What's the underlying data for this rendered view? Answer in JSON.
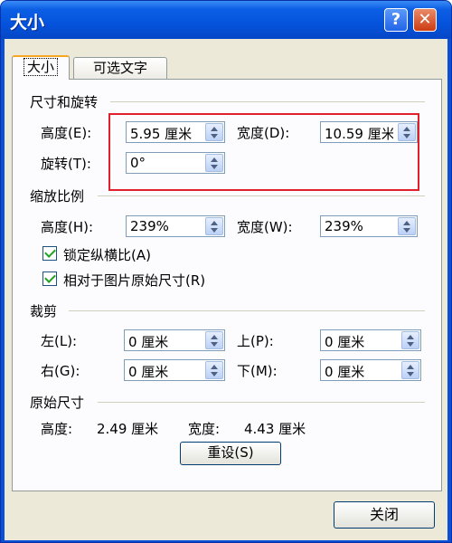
{
  "window": {
    "title": "大小",
    "help_glyph": "?",
    "close_glyph": "✕"
  },
  "tabs": [
    {
      "label": "大小",
      "active": true
    },
    {
      "label": "可选文字",
      "active": false
    }
  ],
  "size_rotate": {
    "title": "尺寸和旋转",
    "height_label": "高度(E):",
    "height_value": "5.95 厘米",
    "width_label": "宽度(D):",
    "width_value": "10.59 厘米",
    "rotate_label": "旋转(T):",
    "rotate_value": "0°"
  },
  "scale": {
    "title": "缩放比例",
    "height_label": "高度(H):",
    "height_value": "239%",
    "width_label": "宽度(W):",
    "width_value": "239%",
    "lock_label": "锁定纵横比(A)",
    "lock_checked": true,
    "relative_label": "相对于图片原始尺寸(R)",
    "relative_checked": true
  },
  "crop": {
    "title": "裁剪",
    "left_label": "左(L):",
    "left_value": "0 厘米",
    "top_label": "上(P):",
    "top_value": "0 厘米",
    "right_label": "右(G):",
    "right_value": "0 厘米",
    "bottom_label": "下(M):",
    "bottom_value": "0 厘米"
  },
  "original": {
    "title": "原始尺寸",
    "height_label": "高度:",
    "height_value": "2.49 厘米",
    "width_label": "宽度:",
    "width_value": "4.43 厘米"
  },
  "buttons": {
    "reset": "重设(S)",
    "close": "关闭"
  },
  "colors": {
    "highlight": "#e1202d",
    "titlebar": "#0553dc"
  }
}
